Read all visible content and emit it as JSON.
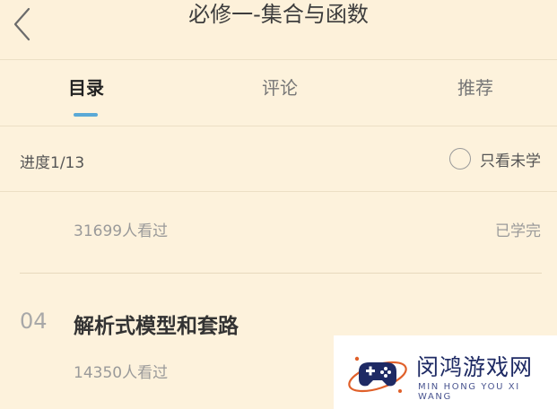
{
  "header": {
    "title": "必修一-集合与函数"
  },
  "tabs": [
    {
      "label": "目录",
      "active": true
    },
    {
      "label": "评论"
    },
    {
      "label": "推荐"
    }
  ],
  "progress": {
    "label": "进度1/13",
    "filter_label": "只看未学"
  },
  "lessons": [
    {
      "number": "",
      "title": "",
      "views": "31699人看过",
      "status": "已学完"
    },
    {
      "number": "04",
      "title": "解析式模型和套路",
      "views": "14350人看过",
      "status": ""
    }
  ],
  "watermark": {
    "name": "闵鸿游戏网",
    "pinyin": "MIN HONG YOU XI WANG"
  },
  "colors": {
    "background": "#fdf2dc",
    "accent": "#5aa9d6",
    "watermark_brand": "#1e2a64"
  }
}
